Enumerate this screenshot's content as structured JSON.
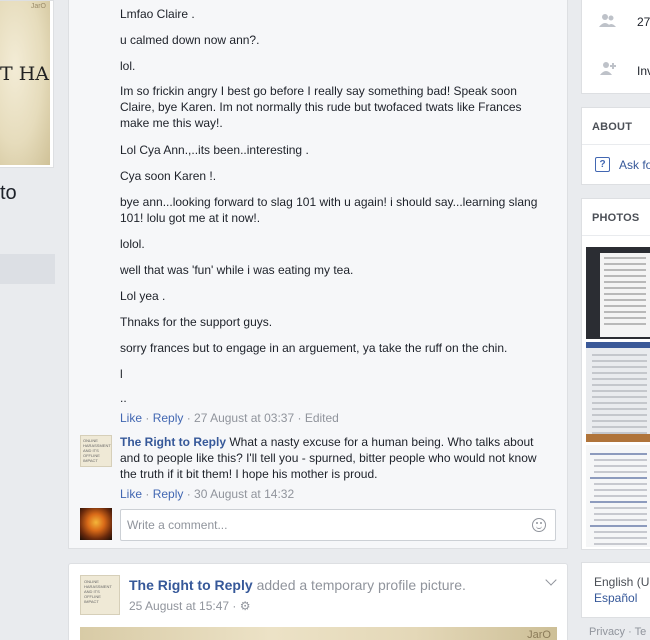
{
  "left": {
    "cover_text": "T HAS",
    "cover_mark": "JarO",
    "name_fragment": "to"
  },
  "comments": {
    "replies": [
      {
        "text": "Lmfao Claire ."
      },
      {
        "text": "u calmed down now ann?."
      },
      {
        "text": "lol."
      },
      {
        "text": "Im so frickin angry I best go before I really say something bad! Speak soon Claire, bye Karen. Im not normally this rude but twofaced twats like Frances make me this way!."
      },
      {
        "text": "Lol Cya Ann.,..its been..interesting ."
      },
      {
        "text": "Cya soon Karen !."
      },
      {
        "text": "bye ann...looking forward to slag 101 with u again! i should say...learning slang 101! lolu got me at it now!."
      },
      {
        "text": "lolol."
      },
      {
        "text": "well that was 'fun' while i was eating my tea."
      },
      {
        "text": "Lol yea ."
      },
      {
        "text": "Thnaks for the support guys."
      },
      {
        "text": "sorry frances but to engage in an arguement, ya take the ruff on the chin."
      },
      {
        "text": "l"
      },
      {
        "text": ".."
      }
    ],
    "meta1": {
      "like": "Like",
      "sep": " · ",
      "reply": "Reply",
      "time": "27 August at 03:37",
      "edited": "Edited"
    },
    "comment2": {
      "author": "The Right to Reply",
      "text": "What a nasty excuse for a human being. Who talks about and to people like this? I'll tell you - spurned, bitter people who would not know the truth if it bit them! I hope his mother is proud.",
      "avatar_text": "ONLINE HARASSMENT AND ITS OFFLINE IMPACT"
    },
    "meta2": {
      "like": "Like",
      "reply": "Reply",
      "time": "30 August at 14:32"
    },
    "composer_placeholder": "Write a comment..."
  },
  "post": {
    "author": "The Right to Reply",
    "action": "added a temporary profile picture.",
    "time": "25 August at 15:47",
    "separator": " · ",
    "image_mark": "JarO"
  },
  "right": {
    "likes_count": "27",
    "invite_fragment": "Inv",
    "about_title": "ABOUT",
    "ask_link": "Ask fo",
    "photos_title": "PHOTOS",
    "lang_current": "English (U",
    "lang_alt": "Español",
    "footer": "Privacy · Te"
  }
}
